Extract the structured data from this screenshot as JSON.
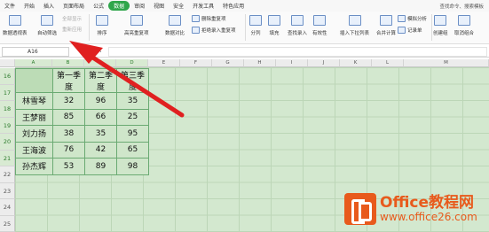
{
  "menu": {
    "items": [
      "文件",
      "开始",
      "插入",
      "页面布局",
      "公式",
      "数据",
      "审阅",
      "视图",
      "安全",
      "开发工具",
      "特色应用"
    ],
    "active": "数据",
    "search": "查找命令、搜索模板"
  },
  "ribbon": {
    "pivot": "数据透视表",
    "autofilter": "自动筛选",
    "show_all": "全部显示",
    "reapply": "重新应用",
    "sort": "排序",
    "highlight_dup": "高亮重复项",
    "data_compare": "数据对比",
    "delete_dup": "删除重复项",
    "reject_dup": "拒绝录入重复项",
    "split": "分列",
    "fill": "填充",
    "find_input": "查找录入",
    "validity": "有效性",
    "dropdown": "插入下拉列表",
    "merge_calc": "合并计算",
    "sim_analysis": "模拟分析",
    "record": "记录单",
    "group": "创建组",
    "ungroup": "取消组合",
    "subtotal": "分类汇总"
  },
  "formula_bar": {
    "name_box": "A16",
    "fx": "fx",
    "zoom": "Q"
  },
  "columns": [
    "A",
    "B",
    "C",
    "D",
    "E",
    "F",
    "G",
    "H",
    "I",
    "J",
    "K",
    "L",
    "M"
  ],
  "rows": [
    "16",
    "17",
    "18",
    "19",
    "20",
    "21",
    "22",
    "23",
    "24",
    "25"
  ],
  "table": {
    "headers": [
      "",
      "第一季度",
      "第二季度",
      "第三季度"
    ],
    "rows": [
      [
        "林雪琴",
        "32",
        "96",
        "35"
      ],
      [
        "王梦丽",
        "85",
        "66",
        "25"
      ],
      [
        "刘力扬",
        "38",
        "35",
        "95"
      ],
      [
        "王海波",
        "76",
        "42",
        "65"
      ],
      [
        "孙杰辉",
        "53",
        "89",
        "98"
      ]
    ]
  },
  "watermark": {
    "line1": "Office教程网",
    "line2": "www.office26.com"
  },
  "colors": {
    "accent": "#2fa64b",
    "arrow": "#e02020",
    "watermark": "#e85a1c"
  }
}
